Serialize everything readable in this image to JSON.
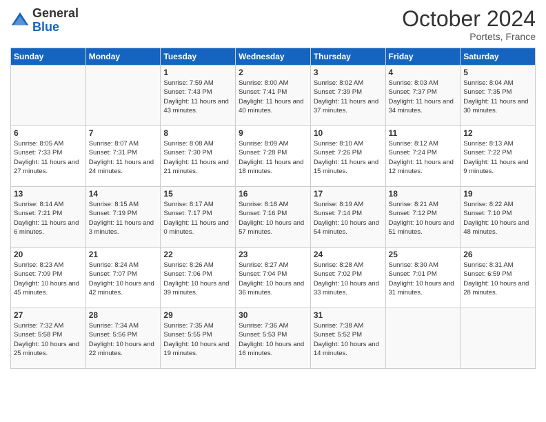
{
  "logo": {
    "general": "General",
    "blue": "Blue"
  },
  "title": "October 2024",
  "location": "Portets, France",
  "days_of_week": [
    "Sunday",
    "Monday",
    "Tuesday",
    "Wednesday",
    "Thursday",
    "Friday",
    "Saturday"
  ],
  "weeks": [
    [
      {
        "day": "",
        "info": ""
      },
      {
        "day": "",
        "info": ""
      },
      {
        "day": "1",
        "info": "Sunrise: 7:59 AM\nSunset: 7:43 PM\nDaylight: 11 hours and 43 minutes."
      },
      {
        "day": "2",
        "info": "Sunrise: 8:00 AM\nSunset: 7:41 PM\nDaylight: 11 hours and 40 minutes."
      },
      {
        "day": "3",
        "info": "Sunrise: 8:02 AM\nSunset: 7:39 PM\nDaylight: 11 hours and 37 minutes."
      },
      {
        "day": "4",
        "info": "Sunrise: 8:03 AM\nSunset: 7:37 PM\nDaylight: 11 hours and 34 minutes."
      },
      {
        "day": "5",
        "info": "Sunrise: 8:04 AM\nSunset: 7:35 PM\nDaylight: 11 hours and 30 minutes."
      }
    ],
    [
      {
        "day": "6",
        "info": "Sunrise: 8:05 AM\nSunset: 7:33 PM\nDaylight: 11 hours and 27 minutes."
      },
      {
        "day": "7",
        "info": "Sunrise: 8:07 AM\nSunset: 7:31 PM\nDaylight: 11 hours and 24 minutes."
      },
      {
        "day": "8",
        "info": "Sunrise: 8:08 AM\nSunset: 7:30 PM\nDaylight: 11 hours and 21 minutes."
      },
      {
        "day": "9",
        "info": "Sunrise: 8:09 AM\nSunset: 7:28 PM\nDaylight: 11 hours and 18 minutes."
      },
      {
        "day": "10",
        "info": "Sunrise: 8:10 AM\nSunset: 7:26 PM\nDaylight: 11 hours and 15 minutes."
      },
      {
        "day": "11",
        "info": "Sunrise: 8:12 AM\nSunset: 7:24 PM\nDaylight: 11 hours and 12 minutes."
      },
      {
        "day": "12",
        "info": "Sunrise: 8:13 AM\nSunset: 7:22 PM\nDaylight: 11 hours and 9 minutes."
      }
    ],
    [
      {
        "day": "13",
        "info": "Sunrise: 8:14 AM\nSunset: 7:21 PM\nDaylight: 11 hours and 6 minutes."
      },
      {
        "day": "14",
        "info": "Sunrise: 8:15 AM\nSunset: 7:19 PM\nDaylight: 11 hours and 3 minutes."
      },
      {
        "day": "15",
        "info": "Sunrise: 8:17 AM\nSunset: 7:17 PM\nDaylight: 11 hours and 0 minutes."
      },
      {
        "day": "16",
        "info": "Sunrise: 8:18 AM\nSunset: 7:16 PM\nDaylight: 10 hours and 57 minutes."
      },
      {
        "day": "17",
        "info": "Sunrise: 8:19 AM\nSunset: 7:14 PM\nDaylight: 10 hours and 54 minutes."
      },
      {
        "day": "18",
        "info": "Sunrise: 8:21 AM\nSunset: 7:12 PM\nDaylight: 10 hours and 51 minutes."
      },
      {
        "day": "19",
        "info": "Sunrise: 8:22 AM\nSunset: 7:10 PM\nDaylight: 10 hours and 48 minutes."
      }
    ],
    [
      {
        "day": "20",
        "info": "Sunrise: 8:23 AM\nSunset: 7:09 PM\nDaylight: 10 hours and 45 minutes."
      },
      {
        "day": "21",
        "info": "Sunrise: 8:24 AM\nSunset: 7:07 PM\nDaylight: 10 hours and 42 minutes."
      },
      {
        "day": "22",
        "info": "Sunrise: 8:26 AM\nSunset: 7:06 PM\nDaylight: 10 hours and 39 minutes."
      },
      {
        "day": "23",
        "info": "Sunrise: 8:27 AM\nSunset: 7:04 PM\nDaylight: 10 hours and 36 minutes."
      },
      {
        "day": "24",
        "info": "Sunrise: 8:28 AM\nSunset: 7:02 PM\nDaylight: 10 hours and 33 minutes."
      },
      {
        "day": "25",
        "info": "Sunrise: 8:30 AM\nSunset: 7:01 PM\nDaylight: 10 hours and 31 minutes."
      },
      {
        "day": "26",
        "info": "Sunrise: 8:31 AM\nSunset: 6:59 PM\nDaylight: 10 hours and 28 minutes."
      }
    ],
    [
      {
        "day": "27",
        "info": "Sunrise: 7:32 AM\nSunset: 5:58 PM\nDaylight: 10 hours and 25 minutes."
      },
      {
        "day": "28",
        "info": "Sunrise: 7:34 AM\nSunset: 5:56 PM\nDaylight: 10 hours and 22 minutes."
      },
      {
        "day": "29",
        "info": "Sunrise: 7:35 AM\nSunset: 5:55 PM\nDaylight: 10 hours and 19 minutes."
      },
      {
        "day": "30",
        "info": "Sunrise: 7:36 AM\nSunset: 5:53 PM\nDaylight: 10 hours and 16 minutes."
      },
      {
        "day": "31",
        "info": "Sunrise: 7:38 AM\nSunset: 5:52 PM\nDaylight: 10 hours and 14 minutes."
      },
      {
        "day": "",
        "info": ""
      },
      {
        "day": "",
        "info": ""
      }
    ]
  ]
}
